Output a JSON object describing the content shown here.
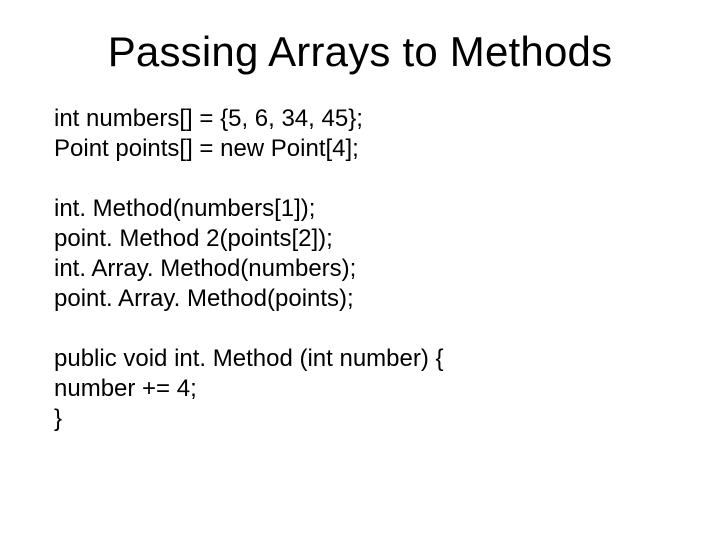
{
  "title": "Passing Arrays to Methods",
  "block1": {
    "line1": "int numbers[] = {5, 6, 34, 45};",
    "line2": "Point points[] = new Point[4];"
  },
  "block2": {
    "line1": "int. Method(numbers[1]);",
    "line2": "point. Method 2(points[2]);",
    "line3": "int. Array. Method(numbers);",
    "line4": "point. Array. Method(points);"
  },
  "block3": {
    "line1": "public void int. Method (int number) {",
    "line2": "number += 4;",
    "line3": "}"
  }
}
